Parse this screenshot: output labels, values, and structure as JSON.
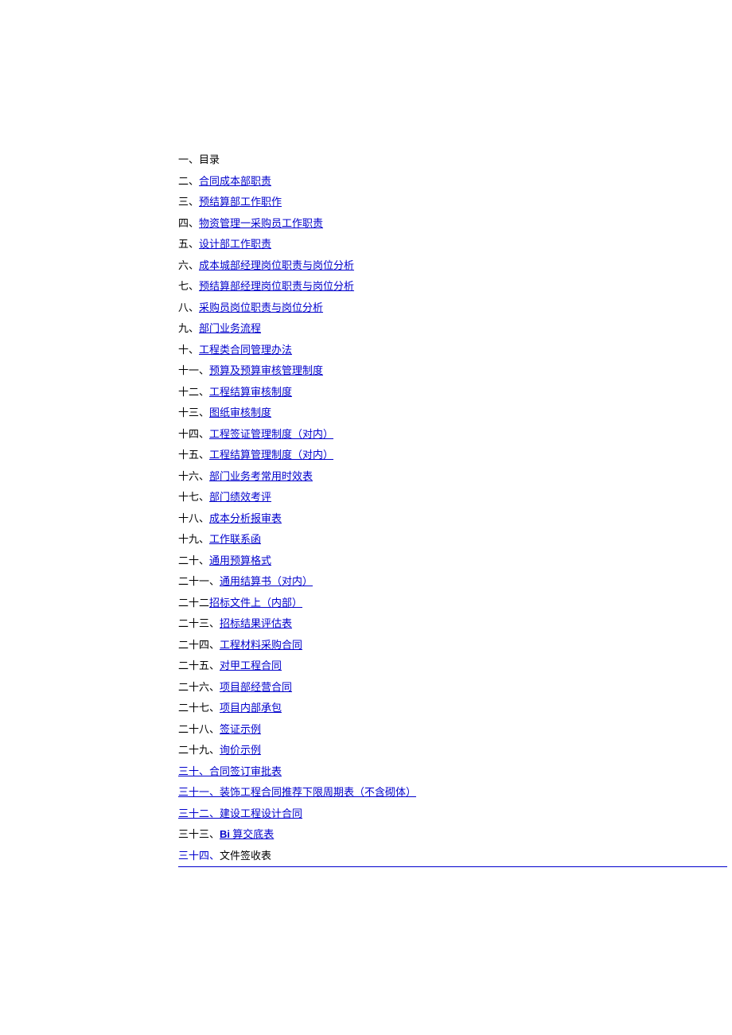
{
  "toc": [
    {
      "prefix": "一、",
      "label": "目录",
      "link": false,
      "fullLink": false
    },
    {
      "prefix": "二、",
      "label": "合同成本部职责",
      "link": true,
      "fullLink": false
    },
    {
      "prefix": "三、",
      "label": "预结算部工作职作",
      "link": true,
      "fullLink": false
    },
    {
      "prefix": "四、",
      "label": "物资管理一采购员工作职责",
      "link": true,
      "fullLink": false
    },
    {
      "prefix": "五、",
      "label": "设计部工作职责",
      "link": true,
      "fullLink": false
    },
    {
      "prefix": "六、",
      "label": "成本城部经理岗位职责与岗位分析",
      "link": true,
      "fullLink": false
    },
    {
      "prefix": "七、",
      "label": "预结算部经理岗位职责与岗位分析",
      "link": true,
      "fullLink": false
    },
    {
      "prefix": "八、",
      "label": "采购员岗位职责与岗位分析",
      "link": true,
      "fullLink": false
    },
    {
      "prefix": "九、",
      "label": "部门业务流程",
      "link": true,
      "fullLink": false
    },
    {
      "prefix": "十、",
      "label": "工程类合同管理办法",
      "link": true,
      "fullLink": false
    },
    {
      "prefix": "十一、",
      "label": "预算及预算审核管理制度",
      "link": true,
      "fullLink": false
    },
    {
      "prefix": "十二、",
      "label": "工程结算审核制度",
      "link": true,
      "fullLink": false
    },
    {
      "prefix": "十三、",
      "label": "图纸审核制度",
      "link": true,
      "fullLink": false
    },
    {
      "prefix": "十四、",
      "label": "工程签证管理制度（对内）",
      "link": true,
      "fullLink": false
    },
    {
      "prefix": "十五、",
      "label": "工程结算管理制度（对内）",
      "link": true,
      "fullLink": false
    },
    {
      "prefix": "十六、",
      "label": "部门业务考常用时效表",
      "link": true,
      "fullLink": false
    },
    {
      "prefix": "十七、",
      "label": "部门绩效考评",
      "link": true,
      "fullLink": false
    },
    {
      "prefix": "十八、",
      "label": "成本分析报审表",
      "link": true,
      "fullLink": false
    },
    {
      "prefix": "十九、",
      "label": "工作联系函",
      "link": true,
      "fullLink": false
    },
    {
      "prefix": "二十、",
      "label": "通用预算格式",
      "link": true,
      "fullLink": false
    },
    {
      "prefix": "二十一、",
      "label": "通用结算书（对内）",
      "link": true,
      "fullLink": false
    },
    {
      "prefix": "二十二",
      "label": "招标文件上（内部）",
      "link": true,
      "fullLink": false
    },
    {
      "prefix": "二十三、",
      "label": "招标结果评估表",
      "link": true,
      "fullLink": false
    },
    {
      "prefix": "二十四、",
      "label": "工程材料采购合同",
      "link": true,
      "fullLink": false
    },
    {
      "prefix": "二十五、",
      "label": "对甲工程合同",
      "link": true,
      "fullLink": false
    },
    {
      "prefix": "二十六、",
      "label": "项目部经营合同",
      "link": true,
      "fullLink": false
    },
    {
      "prefix": "二十七、",
      "label": "项目内部承包",
      "link": true,
      "fullLink": false
    },
    {
      "prefix": "二十八、",
      "label": "签证示例",
      "link": true,
      "fullLink": false
    },
    {
      "prefix": "二十九、",
      "label": "询价示例",
      "link": true,
      "fullLink": false
    },
    {
      "prefix": "三十、",
      "label": "合同签订审批表",
      "link": true,
      "fullLink": true
    },
    {
      "prefix": "三十一、",
      "label": "装饰工程合同推荐下限周期表（不含砌体）",
      "link": true,
      "fullLink": true
    },
    {
      "prefix": "三十二、",
      "label": "建设工程设计合同",
      "link": true,
      "fullLink": true
    }
  ],
  "item33": {
    "prefix": "三十三、",
    "bi": "Bi",
    "rest": " 算交底表"
  },
  "item34": {
    "prefix": "三十四、",
    "label": "文件签收表"
  }
}
